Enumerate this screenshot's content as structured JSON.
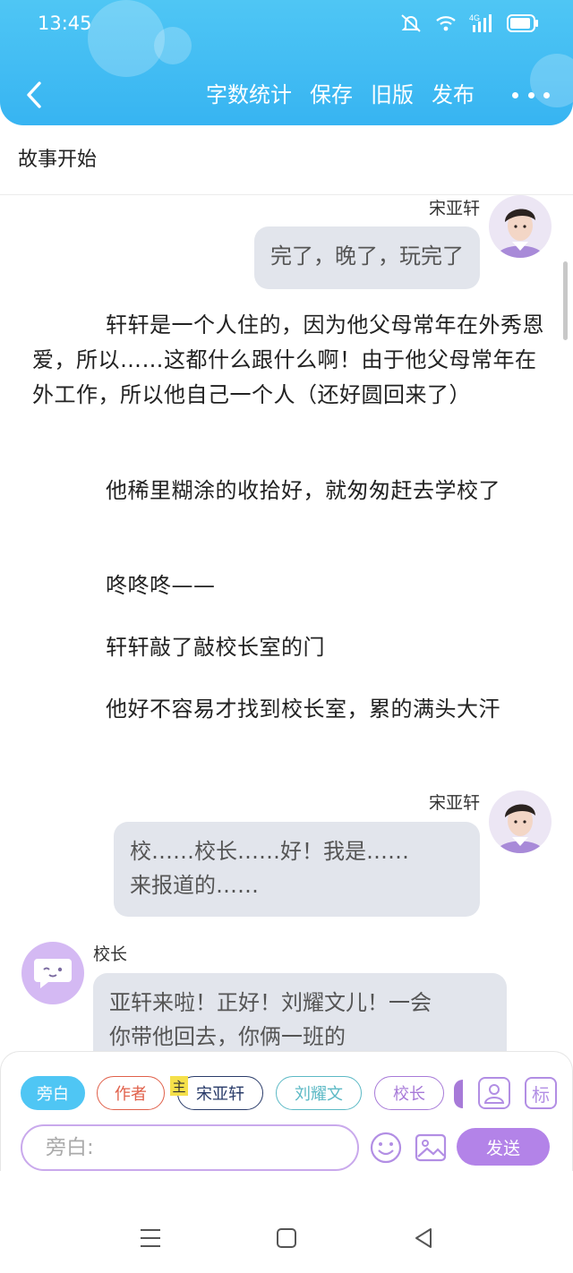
{
  "status_bar": {
    "time": "13:45",
    "network": "4G"
  },
  "toolbar": {
    "word_count": "字数统计",
    "save": "保存",
    "old_version": "旧版",
    "publish": "发布"
  },
  "chapter": {
    "title": "故事开始"
  },
  "messages": [
    {
      "speaker": "宋亚轩",
      "text": "完了，晚了，玩完了"
    },
    {
      "speaker": "宋亚轩",
      "line1": "校……校长……好！我是……",
      "line2": "来报道的……"
    },
    {
      "speaker": "校长",
      "line1": "亚轩来啦！正好！刘耀文儿！一会",
      "line2": "你带他回去，你俩一班的"
    }
  ],
  "paragraphs": [
    "轩轩是一个人住的，因为他父母常年在外秀恩爱，所以……这都什么跟什么啊！由于他父母常年在外工作，所以他自己一个人（还好圆回来了）",
    "他稀里糊涂的收拾好，就匆匆赶去学校了",
    "咚咚咚——",
    "轩轩敲了敲校长室的门",
    "他好不容易才找到校长室，累的满头大汗"
  ],
  "roles": {
    "narrator": "旁白",
    "author": "作者",
    "main_tag": "主",
    "song": "宋亚轩",
    "liu": "刘耀文",
    "principal": "校长"
  },
  "tag_button": "标",
  "input": {
    "placeholder": "旁白:"
  },
  "send": "发送",
  "colors": {
    "header": "#4fc6f4",
    "accent": "#b383e8",
    "bubble": "#e2e5ec"
  }
}
